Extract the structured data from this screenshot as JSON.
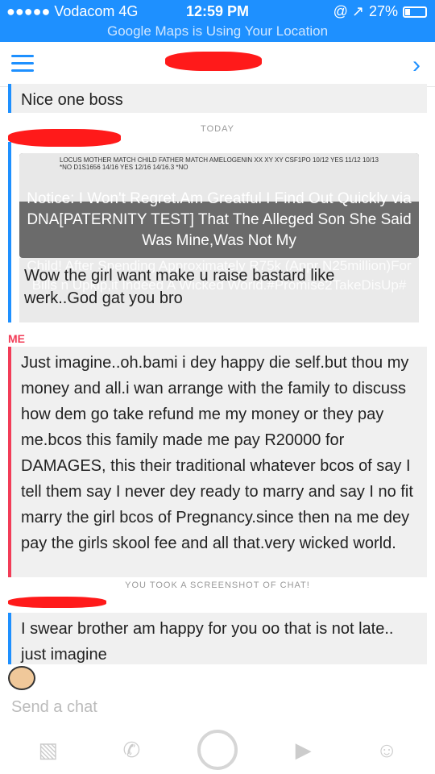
{
  "status_bar": {
    "carrier": "●●●●● Vodacom 4G",
    "time": "12:59 PM",
    "right_icons": "@ ↗",
    "battery": "27%",
    "battery_level": 0.27
  },
  "banner": "Google Maps is Using Your Location",
  "section": {
    "today": "TODAY"
  },
  "messages": {
    "prev": "Nice one boss",
    "notice_doc": "LOCUS    MOTHER MATCH    CHILD    FATHER MATCH  AMELOGENIN  XX  XY  XY  CSF1PO 10/12 YES 11/12 10/13 *NO  D1S1656 14/16 YES 12/16 14/16.3 *NO",
    "notice": "Notice: I Won't Regret.Am Greatful I Find Out Quickly via DNA[PATERNITY TEST] That The Alleged Son She Said Was Mine,Was Not My",
    "ghost_text": "Child! After Spending Approximately R75k (Appr N25million)For Bills n Upkip,it Indeed A Wicked World.#Promise2TakeDisUp#",
    "reply": "Wow the girl want make u raise bastard like werk..God gat you bro",
    "me_label": "ME",
    "me_text": "Just imagine..oh.bami i dey happy die self.but thou my money and all.i wan arrange with the family to discuss how dem go take refund me my money or they pay me.bcos this family made me pay R20000 for DAMAGES, this their traditional whatever bcos of say I tell them say I never dey ready to marry and say I no fit marry the girl bcos of Pregnancy.since then na me dey pay the girls skool fee and all that.very wicked world.",
    "screenshot_note": "YOU TOOK A SCREENSHOT OF CHAT!",
    "last": "I swear brother am happy for you oo that is not late.. just imagine"
  },
  "compose": {
    "placeholder": "Send a chat"
  },
  "toolbar_icons": [
    "image-icon",
    "phone-icon",
    "capture-button",
    "video-icon",
    "emoji-icon"
  ],
  "colors": {
    "accent": "#1e90ff",
    "me": "#f23c57",
    "redaction": "#ff1a1a"
  }
}
